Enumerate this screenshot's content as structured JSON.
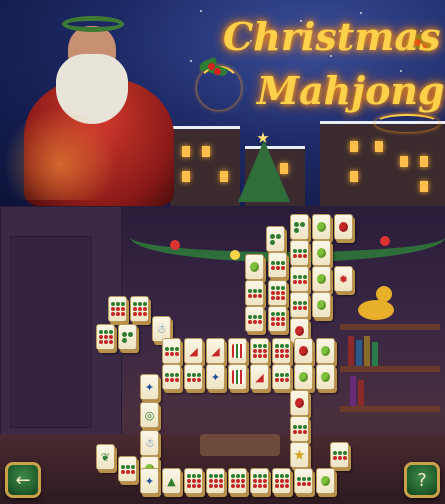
{
  "banner": {
    "title_line1": "Christmas",
    "title_line2": "Mahjong"
  },
  "icons": {
    "left_corner": "exit-door-icon",
    "right_corner": "hint-icon"
  },
  "colors": {
    "title_glow": "#ffd14a",
    "tile_face": "#fbf6e6",
    "tile_edge": "#b8904a",
    "button_green": "#1f5a2a",
    "button_border": "#c9a14a"
  },
  "tile_types": {
    "dots9": "nine-red-green-dots",
    "dots6": "six-red-green-dots",
    "dots3": "three-green-dots",
    "ornament-green": "green-ornament",
    "ornament-red": "red-ornament",
    "snowman": "snowman",
    "reindeer": "reindeer",
    "wreath": "wreath",
    "stocking": "stocking",
    "stripes": "candy-stripes",
    "holly": "holly",
    "poinsettia": "poinsettia",
    "tree": "christmas-tree",
    "star": "star"
  }
}
